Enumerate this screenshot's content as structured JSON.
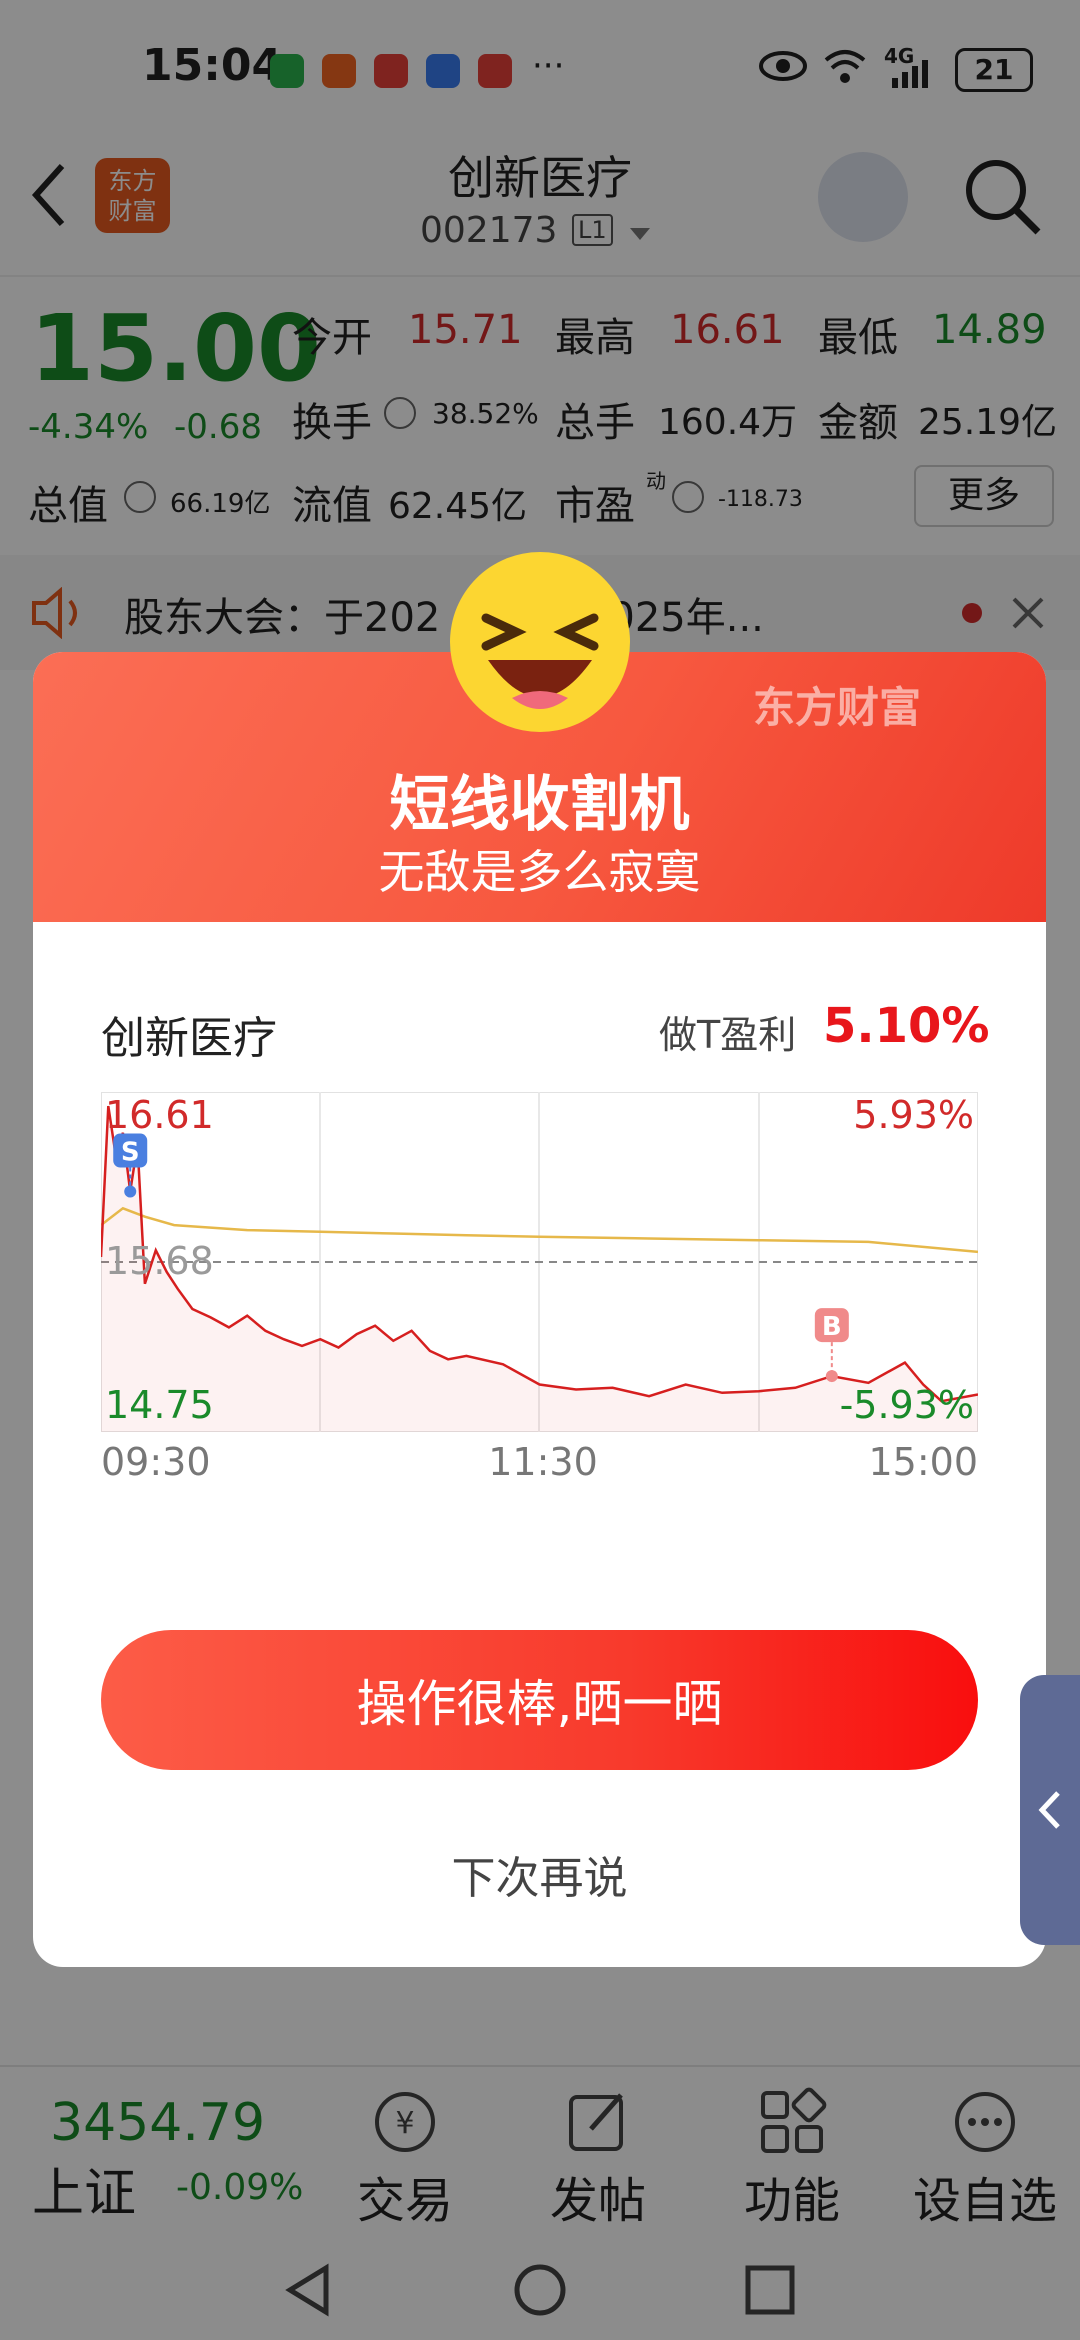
{
  "status_bar": {
    "time": "15:04",
    "network": "4G",
    "battery": "21",
    "more": "···"
  },
  "header": {
    "logo_line1": "东方",
    "logo_line2": "财富",
    "stock_name": "创新医疗",
    "stock_code": "002173",
    "level": "L1"
  },
  "quote": {
    "price": "15.00",
    "change_pct": "-4.34%",
    "change": "-0.68",
    "open_label": "今开",
    "open": "15.71",
    "high_label": "最高",
    "high": "16.61",
    "low_label": "最低",
    "low": "14.89",
    "turnover_label": "换手",
    "turnover": "38.52%",
    "volume_label": "总手",
    "volume": "160.4万",
    "amount_label": "金额",
    "amount": "25.19亿",
    "mktcap_label": "总值",
    "mktcap": "66.19亿",
    "float_label": "流值",
    "float": "62.45亿",
    "pe_label": "市盈",
    "pe_sup": "动",
    "pe": "-118.73",
    "more_button": "更多"
  },
  "notice": {
    "text": "股东大会：于202   4召开2025年..."
  },
  "modal": {
    "brand": "东方财富",
    "title": "短线收割机",
    "subtitle": "无敌是多么寂寞",
    "stock_name": "创新医疗",
    "profit_label": "做T盈利",
    "profit": "5.10%",
    "chart_labels": {
      "high_price": "16.61",
      "high_pct": "5.93%",
      "mid_price": "15.68",
      "low_price": "14.75",
      "low_pct": "-5.93%",
      "sell_marker": "S",
      "buy_marker": "B"
    },
    "share_button": "操作很棒,晒一晒",
    "later_button": "下次再说"
  },
  "chart_data": {
    "type": "line",
    "x_ticks": [
      "09:30",
      "11:30",
      "15:00"
    ],
    "ylim": [
      14.75,
      16.61
    ],
    "y_ticks_left": [
      "16.61",
      "15.68",
      "14.75"
    ],
    "y_ticks_right": [
      "5.93%",
      "",
      "-5.93%"
    ],
    "reference_price": 15.68,
    "series": [
      {
        "role": "price",
        "color": "#d61f1f",
        "x": [
          0,
          2,
          4,
          6,
          8,
          10,
          12,
          15,
          18,
          21,
          25,
          30,
          35,
          40,
          45,
          50,
          55,
          60,
          65,
          70,
          75,
          80,
          85,
          90,
          95,
          100,
          110,
          120,
          130,
          140,
          150,
          160,
          170,
          180,
          190,
          200,
          210,
          220,
          225,
          230,
          240
        ],
        "values": [
          15.71,
          16.61,
          16.32,
          16.45,
          16.1,
          16.38,
          15.55,
          15.75,
          15.62,
          15.52,
          15.4,
          15.35,
          15.29,
          15.36,
          15.27,
          15.22,
          15.18,
          15.22,
          15.17,
          15.25,
          15.3,
          15.21,
          15.27,
          15.15,
          15.1,
          15.12,
          15.07,
          14.95,
          14.92,
          14.93,
          14.88,
          14.95,
          14.9,
          14.91,
          14.93,
          15.0,
          14.96,
          15.08,
          14.95,
          14.85,
          14.89
        ]
      },
      {
        "role": "average",
        "color": "#e6b84a",
        "x": [
          0,
          6,
          12,
          20,
          40,
          60,
          80,
          100,
          120,
          150,
          180,
          210,
          240
        ],
        "values": [
          15.9,
          16.0,
          15.95,
          15.9,
          15.87,
          15.86,
          15.85,
          15.84,
          15.83,
          15.82,
          15.81,
          15.8,
          15.74
        ]
      }
    ],
    "markers": [
      {
        "label": "S",
        "x": 8,
        "value": 16.1
      },
      {
        "label": "B",
        "x": 200,
        "value": 15.0
      }
    ]
  },
  "bottom_nav": {
    "index_value": "3454.79",
    "index_name": "上证",
    "index_change": "-0.09%",
    "trade": "交易",
    "post": "发帖",
    "functions": "功能",
    "watchlist": "设自选"
  },
  "colors": {
    "up": "#d12a2a",
    "down": "#1a8a2a",
    "accent": "#f7583f"
  }
}
